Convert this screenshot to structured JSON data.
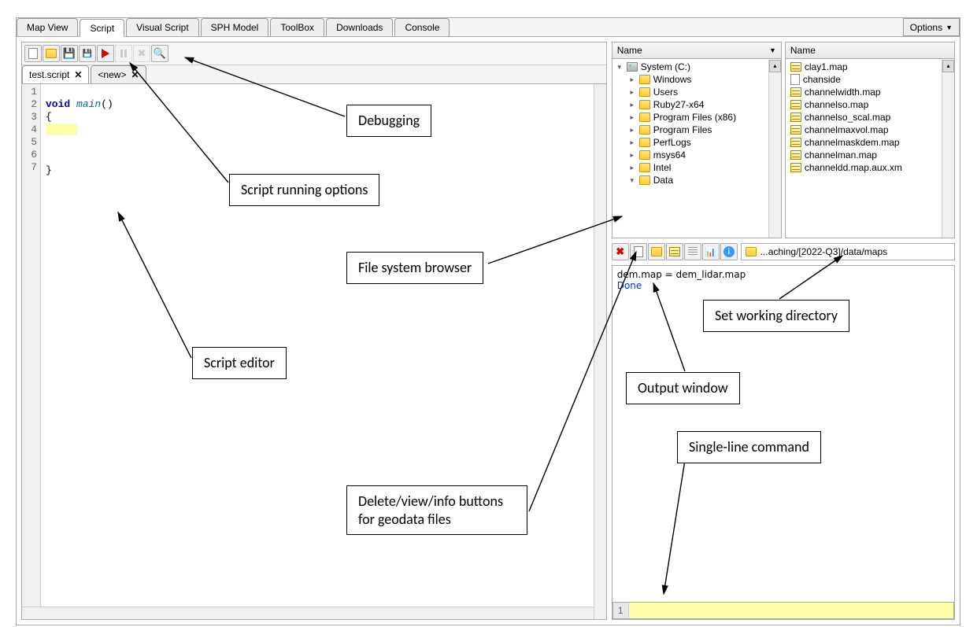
{
  "tabs": {
    "items": [
      "Map View",
      "Script",
      "Visual Script",
      "SPH Model",
      "ToolBox",
      "Downloads",
      "Console"
    ],
    "active_index": 1,
    "options_label": "Options"
  },
  "toolbar": {
    "new": "new-icon",
    "open": "open-icon",
    "save": "save-icon",
    "saveall": "saveall-icon",
    "run": "run-icon",
    "pause": "pause-icon",
    "stop": "stop-icon",
    "debug": "debug-icon"
  },
  "script_tabs": {
    "items": [
      {
        "label": "test.script",
        "active": true
      },
      {
        "label": "<new>",
        "active": false
      }
    ]
  },
  "editor": {
    "lines": [
      "1",
      "2",
      "3",
      "4",
      "5",
      "6",
      "7"
    ],
    "code": {
      "l1_kw": "void",
      "l1_fn": "main",
      "l1_rest": "()",
      "l2": "{",
      "l6": "}"
    },
    "highlight_line": 3
  },
  "file_tree": {
    "header": "Name",
    "root": {
      "label": "System (C:)",
      "type": "drive",
      "expanded": true
    },
    "children": [
      {
        "label": "Windows",
        "expanded": false
      },
      {
        "label": "Users",
        "expanded": false
      },
      {
        "label": "Ruby27-x64",
        "expanded": false
      },
      {
        "label": "Program Files (x86)",
        "expanded": false
      },
      {
        "label": "Program Files",
        "expanded": false
      },
      {
        "label": "PerfLogs",
        "expanded": false
      },
      {
        "label": "msys64",
        "expanded": false
      },
      {
        "label": "Intel",
        "expanded": false
      },
      {
        "label": "Data",
        "expanded": true
      }
    ]
  },
  "file_list": {
    "header": "Name",
    "items": [
      {
        "label": "clay1.map",
        "type": "map"
      },
      {
        "label": "chanside",
        "type": "file"
      },
      {
        "label": "channelwidth.map",
        "type": "map"
      },
      {
        "label": "channelso.map",
        "type": "map"
      },
      {
        "label": "channelso_scal.map",
        "type": "map"
      },
      {
        "label": "channelmaxvol.map",
        "type": "map"
      },
      {
        "label": "channelmaskdem.map",
        "type": "map"
      },
      {
        "label": "channelman.map",
        "type": "map"
      },
      {
        "label": "channeldd.map.aux.xm",
        "type": "map"
      }
    ]
  },
  "geo_toolbar": {
    "delete": "delete-icon",
    "new": "new-file-icon",
    "open": "open-folder-icon",
    "table": "table-icon",
    "list": "list-icon",
    "chart": "chart-icon",
    "info": "info-icon"
  },
  "working_dir": {
    "path": "...aching/[2022-Q3]/data/maps"
  },
  "output": {
    "line1": "dem.map = dem_lidar.map",
    "line2": "Done"
  },
  "command": {
    "line_number": "1",
    "value": ""
  },
  "annotations": {
    "debugging": "Debugging",
    "running": "Script running options",
    "editor": "Script editor",
    "fsbrowser": "File system browser",
    "geodata": "Delete/view/info buttons for geodata files",
    "output": "Output window",
    "setwd": "Set working directory",
    "cmd": "Single-line command"
  }
}
